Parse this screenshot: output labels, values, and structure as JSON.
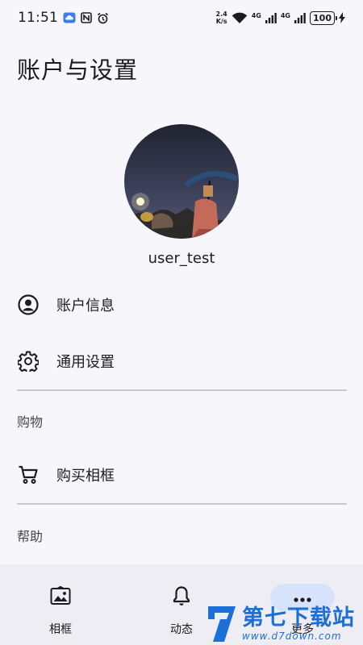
{
  "status_bar": {
    "time": "11:51",
    "speed_value": "2.4",
    "speed_unit": "K/s",
    "net1": "4G",
    "net2": "4G",
    "battery": "100"
  },
  "page": {
    "title": "账户与设置"
  },
  "profile": {
    "username": "user_test"
  },
  "menu": {
    "account_info": "账户信息",
    "general_settings": "通用设置",
    "shopping_header": "购物",
    "buy_frame": "购买相框",
    "help_header": "帮助"
  },
  "bottom_nav": {
    "items": [
      {
        "label": "相框",
        "icon": "image-frame-icon"
      },
      {
        "label": "动态",
        "icon": "bell-icon"
      },
      {
        "label": "更多",
        "icon": "more-horizontal-icon"
      }
    ],
    "active_index": 2
  },
  "watermark": {
    "main": "第七下载站",
    "sub": "www.d7down.com"
  },
  "colors": {
    "background": "#f7f6fb",
    "nav_bg": "#eeedf3",
    "active_pill": "#d7e3fb",
    "watermark": "#1c6fd6"
  }
}
